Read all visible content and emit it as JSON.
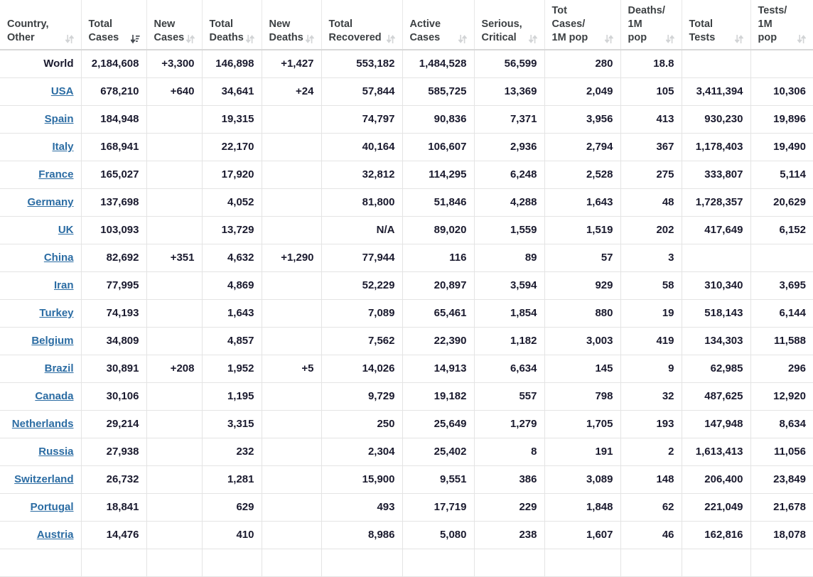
{
  "table": {
    "columns": [
      {
        "label": "Country,\nOther",
        "line1": "Country,",
        "line2": "Other",
        "sort": "both",
        "key": "country"
      },
      {
        "label": "Total Cases",
        "line1": "Total",
        "line2": "Cases",
        "sort": "desc",
        "key": "total_cases"
      },
      {
        "label": "New Cases",
        "line1": "New",
        "line2": "Cases",
        "sort": "both",
        "key": "new_cases"
      },
      {
        "label": "Total Deaths",
        "line1": "Total",
        "line2": "Deaths",
        "sort": "both",
        "key": "total_deaths"
      },
      {
        "label": "New Deaths",
        "line1": "New",
        "line2": "Deaths",
        "sort": "both",
        "key": "new_deaths"
      },
      {
        "label": "Total Recovered",
        "line1": "Total",
        "line2": "Recovered",
        "sort": "both",
        "key": "total_recovered"
      },
      {
        "label": "Active Cases",
        "line1": "Active",
        "line2": "Cases",
        "sort": "both",
        "key": "active_cases"
      },
      {
        "label": "Serious, Critical",
        "line1": "Serious,",
        "line2": "Critical",
        "sort": "both",
        "key": "serious_critical"
      },
      {
        "label": "Tot Cases/1M pop",
        "line1": "Tot Cases/",
        "line2": "1M pop",
        "sort": "both",
        "key": "cases_per_1m"
      },
      {
        "label": "Deaths/1M pop",
        "line1": "Deaths/",
        "line2": "1M pop",
        "sort": "both",
        "key": "deaths_per_1m"
      },
      {
        "label": "Total Tests",
        "line1": "Total",
        "line2": "Tests",
        "sort": "both",
        "key": "total_tests"
      },
      {
        "label": "Tests/1M pop",
        "line1": "Tests/",
        "line2": "1M pop",
        "sort": "both",
        "key": "tests_per_1m"
      }
    ],
    "world_row": {
      "country": "World",
      "total_cases": "2,184,608",
      "new_cases": "+3,300",
      "total_deaths": "146,898",
      "new_deaths": "+1,427",
      "total_recovered": "553,182",
      "active_cases": "1,484,528",
      "serious_critical": "56,599",
      "cases_per_1m": "280",
      "deaths_per_1m": "18.8",
      "total_tests": "",
      "tests_per_1m": ""
    },
    "rows": [
      {
        "country": "USA",
        "total_cases": "678,210",
        "new_cases": "+640",
        "total_deaths": "34,641",
        "new_deaths": "+24",
        "total_recovered": "57,844",
        "active_cases": "585,725",
        "serious_critical": "13,369",
        "cases_per_1m": "2,049",
        "deaths_per_1m": "105",
        "total_tests": "3,411,394",
        "tests_per_1m": "10,306"
      },
      {
        "country": "Spain",
        "total_cases": "184,948",
        "new_cases": "",
        "total_deaths": "19,315",
        "new_deaths": "",
        "total_recovered": "74,797",
        "active_cases": "90,836",
        "serious_critical": "7,371",
        "cases_per_1m": "3,956",
        "deaths_per_1m": "413",
        "total_tests": "930,230",
        "tests_per_1m": "19,896"
      },
      {
        "country": "Italy",
        "total_cases": "168,941",
        "new_cases": "",
        "total_deaths": "22,170",
        "new_deaths": "",
        "total_recovered": "40,164",
        "active_cases": "106,607",
        "serious_critical": "2,936",
        "cases_per_1m": "2,794",
        "deaths_per_1m": "367",
        "total_tests": "1,178,403",
        "tests_per_1m": "19,490"
      },
      {
        "country": "France",
        "total_cases": "165,027",
        "new_cases": "",
        "total_deaths": "17,920",
        "new_deaths": "",
        "total_recovered": "32,812",
        "active_cases": "114,295",
        "serious_critical": "6,248",
        "cases_per_1m": "2,528",
        "deaths_per_1m": "275",
        "total_tests": "333,807",
        "tests_per_1m": "5,114"
      },
      {
        "country": "Germany",
        "total_cases": "137,698",
        "new_cases": "",
        "total_deaths": "4,052",
        "new_deaths": "",
        "total_recovered": "81,800",
        "active_cases": "51,846",
        "serious_critical": "4,288",
        "cases_per_1m": "1,643",
        "deaths_per_1m": "48",
        "total_tests": "1,728,357",
        "tests_per_1m": "20,629"
      },
      {
        "country": "UK",
        "total_cases": "103,093",
        "new_cases": "",
        "total_deaths": "13,729",
        "new_deaths": "",
        "total_recovered": "N/A",
        "active_cases": "89,020",
        "serious_critical": "1,559",
        "cases_per_1m": "1,519",
        "deaths_per_1m": "202",
        "total_tests": "417,649",
        "tests_per_1m": "6,152"
      },
      {
        "country": "China",
        "total_cases": "82,692",
        "new_cases": "+351",
        "total_deaths": "4,632",
        "new_deaths": "+1,290",
        "total_recovered": "77,944",
        "active_cases": "116",
        "serious_critical": "89",
        "cases_per_1m": "57",
        "deaths_per_1m": "3",
        "total_tests": "",
        "tests_per_1m": ""
      },
      {
        "country": "Iran",
        "total_cases": "77,995",
        "new_cases": "",
        "total_deaths": "4,869",
        "new_deaths": "",
        "total_recovered": "52,229",
        "active_cases": "20,897",
        "serious_critical": "3,594",
        "cases_per_1m": "929",
        "deaths_per_1m": "58",
        "total_tests": "310,340",
        "tests_per_1m": "3,695"
      },
      {
        "country": "Turkey",
        "total_cases": "74,193",
        "new_cases": "",
        "total_deaths": "1,643",
        "new_deaths": "",
        "total_recovered": "7,089",
        "active_cases": "65,461",
        "serious_critical": "1,854",
        "cases_per_1m": "880",
        "deaths_per_1m": "19",
        "total_tests": "518,143",
        "tests_per_1m": "6,144"
      },
      {
        "country": "Belgium",
        "total_cases": "34,809",
        "new_cases": "",
        "total_deaths": "4,857",
        "new_deaths": "",
        "total_recovered": "7,562",
        "active_cases": "22,390",
        "serious_critical": "1,182",
        "cases_per_1m": "3,003",
        "deaths_per_1m": "419",
        "total_tests": "134,303",
        "tests_per_1m": "11,588"
      },
      {
        "country": "Brazil",
        "total_cases": "30,891",
        "new_cases": "+208",
        "total_deaths": "1,952",
        "new_deaths": "+5",
        "total_recovered": "14,026",
        "active_cases": "14,913",
        "serious_critical": "6,634",
        "cases_per_1m": "145",
        "deaths_per_1m": "9",
        "total_tests": "62,985",
        "tests_per_1m": "296"
      },
      {
        "country": "Canada",
        "total_cases": "30,106",
        "new_cases": "",
        "total_deaths": "1,195",
        "new_deaths": "",
        "total_recovered": "9,729",
        "active_cases": "19,182",
        "serious_critical": "557",
        "cases_per_1m": "798",
        "deaths_per_1m": "32",
        "total_tests": "487,625",
        "tests_per_1m": "12,920"
      },
      {
        "country": "Netherlands",
        "total_cases": "29,214",
        "new_cases": "",
        "total_deaths": "3,315",
        "new_deaths": "",
        "total_recovered": "250",
        "active_cases": "25,649",
        "serious_critical": "1,279",
        "cases_per_1m": "1,705",
        "deaths_per_1m": "193",
        "total_tests": "147,948",
        "tests_per_1m": "8,634"
      },
      {
        "country": "Russia",
        "total_cases": "27,938",
        "new_cases": "",
        "total_deaths": "232",
        "new_deaths": "",
        "total_recovered": "2,304",
        "active_cases": "25,402",
        "serious_critical": "8",
        "cases_per_1m": "191",
        "deaths_per_1m": "2",
        "total_tests": "1,613,413",
        "tests_per_1m": "11,056"
      },
      {
        "country": "Switzerland",
        "total_cases": "26,732",
        "new_cases": "",
        "total_deaths": "1,281",
        "new_deaths": "",
        "total_recovered": "15,900",
        "active_cases": "9,551",
        "serious_critical": "386",
        "cases_per_1m": "3,089",
        "deaths_per_1m": "148",
        "total_tests": "206,400",
        "tests_per_1m": "23,849"
      },
      {
        "country": "Portugal",
        "total_cases": "18,841",
        "new_cases": "",
        "total_deaths": "629",
        "new_deaths": "",
        "total_recovered": "493",
        "active_cases": "17,719",
        "serious_critical": "229",
        "cases_per_1m": "1,848",
        "deaths_per_1m": "62",
        "total_tests": "221,049",
        "tests_per_1m": "21,678"
      },
      {
        "country": "Austria",
        "total_cases": "14,476",
        "new_cases": "",
        "total_deaths": "410",
        "new_deaths": "",
        "total_recovered": "8,986",
        "active_cases": "5,080",
        "serious_critical": "238",
        "cases_per_1m": "1,607",
        "deaths_per_1m": "46",
        "total_tests": "162,816",
        "tests_per_1m": "18,078"
      }
    ],
    "colors": {
      "new_cases_highlight": "#fcecab",
      "new_deaths_highlight": "#ff0000",
      "world_row_background": "#dcdcdc",
      "country_link": "#2b6ca3",
      "cell_text": "#1a1a2e",
      "header_text": "#3c4043"
    }
  }
}
